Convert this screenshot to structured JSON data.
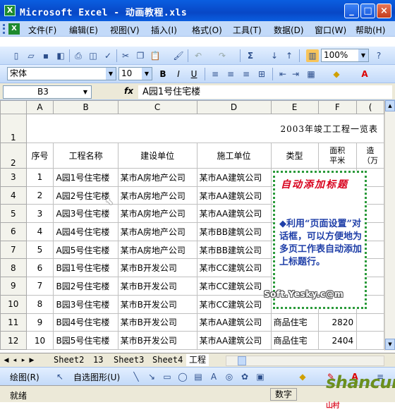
{
  "window": {
    "app_icon": "excel-icon",
    "title": "Microsoft Excel - 动画教程.xls",
    "buttons": [
      "minimize",
      "maximize",
      "close"
    ]
  },
  "menubar": {
    "items": [
      "文件(F)",
      "编辑(E)",
      "视图(V)",
      "插入(I)",
      "格式(O)",
      "工具(T)",
      "数据(D)",
      "窗口(W)",
      "帮助(H)"
    ]
  },
  "format_toolbar": {
    "font": "宋体",
    "size": "10",
    "zoom": "100%",
    "bold": "B",
    "italic": "I",
    "underline": "U"
  },
  "formula_bar": {
    "cell_ref": "B3",
    "fx": "fx",
    "content": "A园1号住宅楼"
  },
  "columns": [
    "A",
    "B",
    "C",
    "D",
    "E",
    "F",
    "("
  ],
  "row_numbers": [
    "1",
    "2",
    "3",
    "4",
    "5",
    "6",
    "7",
    "8",
    "9",
    "10",
    "11",
    "12"
  ],
  "sheet_title": "2003年竣工工程一览表",
  "headers": {
    "seq": "序号",
    "name": "工程名称",
    "builder": "建设单位",
    "contractor": "施工单位",
    "type": "类型",
    "area_line1": "面积",
    "area_line2": "平米",
    "cost_line1": "造",
    "cost_line2": "（万"
  },
  "rows": [
    {
      "seq": "1",
      "name": "A园1号住宅楼",
      "builder": "某市A房地产公司",
      "contractor": "某市AA建筑公司",
      "type": "",
      "area": ""
    },
    {
      "seq": "2",
      "name": "A园2号住宅楼",
      "builder": "某市A房地产公司",
      "contractor": "某市AA建筑公司",
      "type": "",
      "area": ""
    },
    {
      "seq": "3",
      "name": "A园3号住宅楼",
      "builder": "某市A房地产公司",
      "contractor": "某市AA建筑公司",
      "type": "",
      "area": ""
    },
    {
      "seq": "4",
      "name": "A园4号住宅楼",
      "builder": "某市A房地产公司",
      "contractor": "某市BB建筑公司",
      "type": "",
      "area": ""
    },
    {
      "seq": "5",
      "name": "A园5号住宅楼",
      "builder": "某市A房地产公司",
      "contractor": "某市BB建筑公司",
      "type": "",
      "area": ""
    },
    {
      "seq": "6",
      "name": "B园1号住宅楼",
      "builder": "某市B开发公司",
      "contractor": "某市CC建筑公司",
      "type": "",
      "area": ""
    },
    {
      "seq": "7",
      "name": "B园2号住宅楼",
      "builder": "某市B开发公司",
      "contractor": "某市CC建筑公司",
      "type": "",
      "area": ""
    },
    {
      "seq": "8",
      "name": "B园3号住宅楼",
      "builder": "某市B开发公司",
      "contractor": "某市CC建筑公司",
      "type": "",
      "area": ""
    },
    {
      "seq": "9",
      "name": "B园4号住宅楼",
      "builder": "某市B开发公司",
      "contractor": "某市AA建筑公司",
      "type": "商品住宅",
      "area": "2820"
    },
    {
      "seq": "10",
      "name": "B园5号住宅楼",
      "builder": "某市B开发公司",
      "contractor": "某市AA建筑公司",
      "type": "商品住宅",
      "area": "2404"
    }
  ],
  "callout": {
    "title": "自动添加标题",
    "body": "◆利用“页面设置”对话框，可以方便地为多页工作表自动添加上标题行。",
    "watermark": "Soft.Yesky.c@m"
  },
  "sheet_tabs": [
    "Sheet2",
    "13",
    "Sheet3",
    "Sheet4",
    "工程"
  ],
  "active_tab": "工程",
  "drawing_toolbar": {
    "draw_label": "绘图(R)",
    "autoshape_label": "自选图形(U)"
  },
  "status": {
    "ready": "就绪",
    "mode": "数字"
  },
  "logo": {
    "text": "shancun",
    "sub": "山村"
  }
}
